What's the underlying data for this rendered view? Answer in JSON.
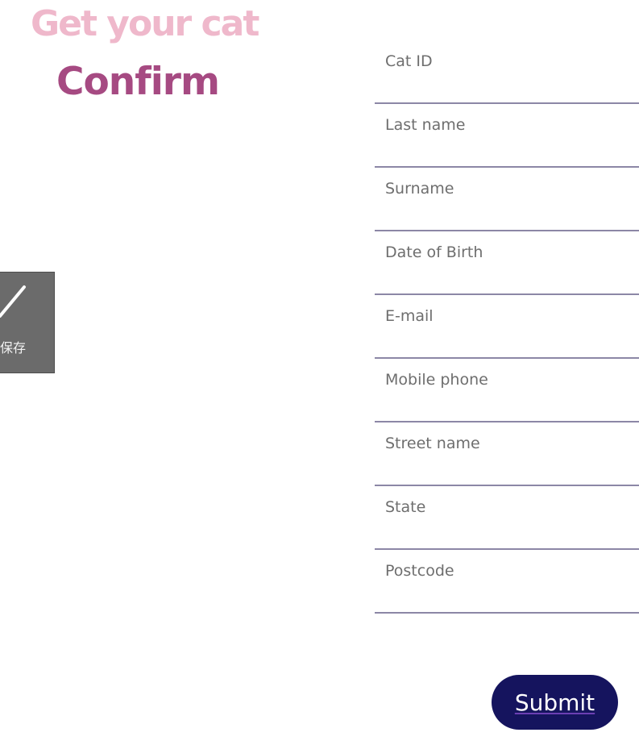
{
  "header": {
    "tagline": "Get your cat",
    "title": "Confirm"
  },
  "save_widget": {
    "label": "保存",
    "icon": "slash-icon"
  },
  "form": {
    "fields": [
      {
        "placeholder": "Cat ID",
        "value": ""
      },
      {
        "placeholder": "Last name",
        "value": ""
      },
      {
        "placeholder": "Surname",
        "value": ""
      },
      {
        "placeholder": "Date of Birth",
        "value": ""
      },
      {
        "placeholder": "E-mail",
        "value": ""
      },
      {
        "placeholder": "Mobile phone",
        "value": ""
      },
      {
        "placeholder": "Street name",
        "value": ""
      },
      {
        "placeholder": "State",
        "value": ""
      },
      {
        "placeholder": "Postcode",
        "value": ""
      }
    ],
    "submit_label": "Submit"
  },
  "colors": {
    "tagline": "#efb8cb",
    "title": "#a64a82",
    "field_underline": "#8c87a6",
    "submit_bg": "#15145e",
    "save_widget_bg": "#6b6b6b"
  }
}
